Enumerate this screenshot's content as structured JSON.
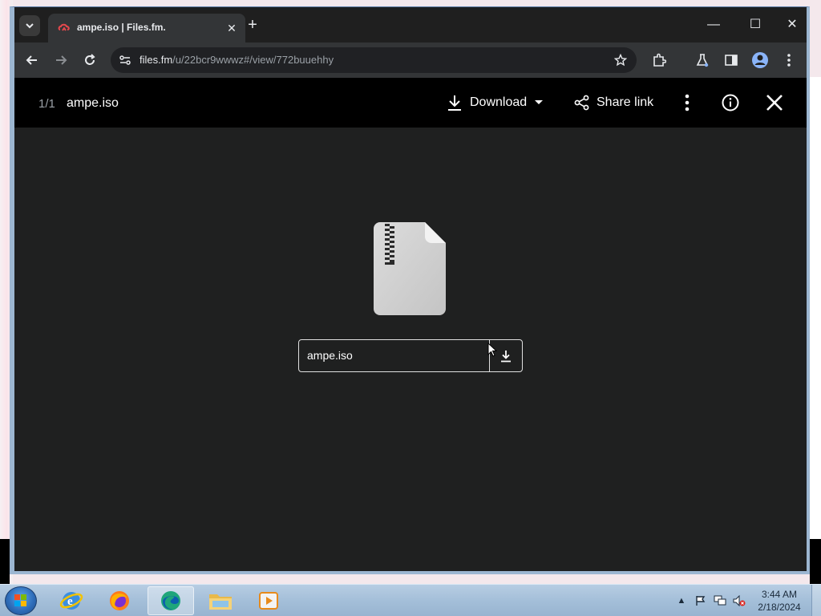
{
  "browser": {
    "tab_title": "ampe.iso | Files.fm.",
    "new_tab_label": "+",
    "url_host": "files.fm",
    "url_path": "/u/22bcr9wwwz#/view/772buuehhy"
  },
  "viewer": {
    "counter": "1/1",
    "file_name": "ampe.iso",
    "download_label": "Download",
    "share_label": "Share link"
  },
  "file_card": {
    "name": "ampe.iso"
  },
  "taskbar": {
    "time": "3:44 AM",
    "date": "2/18/2024"
  },
  "colors": {
    "viewer_bg": "#1f2020",
    "header_bg": "#000000",
    "chrome_dark": "#1f1f1f",
    "chrome_toolbar": "#333537",
    "brand_red": "#e5484d"
  },
  "icons": [
    "tab-search-icon",
    "files-fm-logo-icon",
    "close-icon",
    "back-arrow-icon",
    "forward-arrow-icon",
    "reload-icon",
    "site-info-icon",
    "star-icon",
    "extensions-icon",
    "labs-icon",
    "side-panel-icon",
    "profile-icon",
    "kebab-menu-icon",
    "download-icon",
    "chevron-down-icon",
    "share-icon",
    "info-icon",
    "zip-file-icon"
  ]
}
